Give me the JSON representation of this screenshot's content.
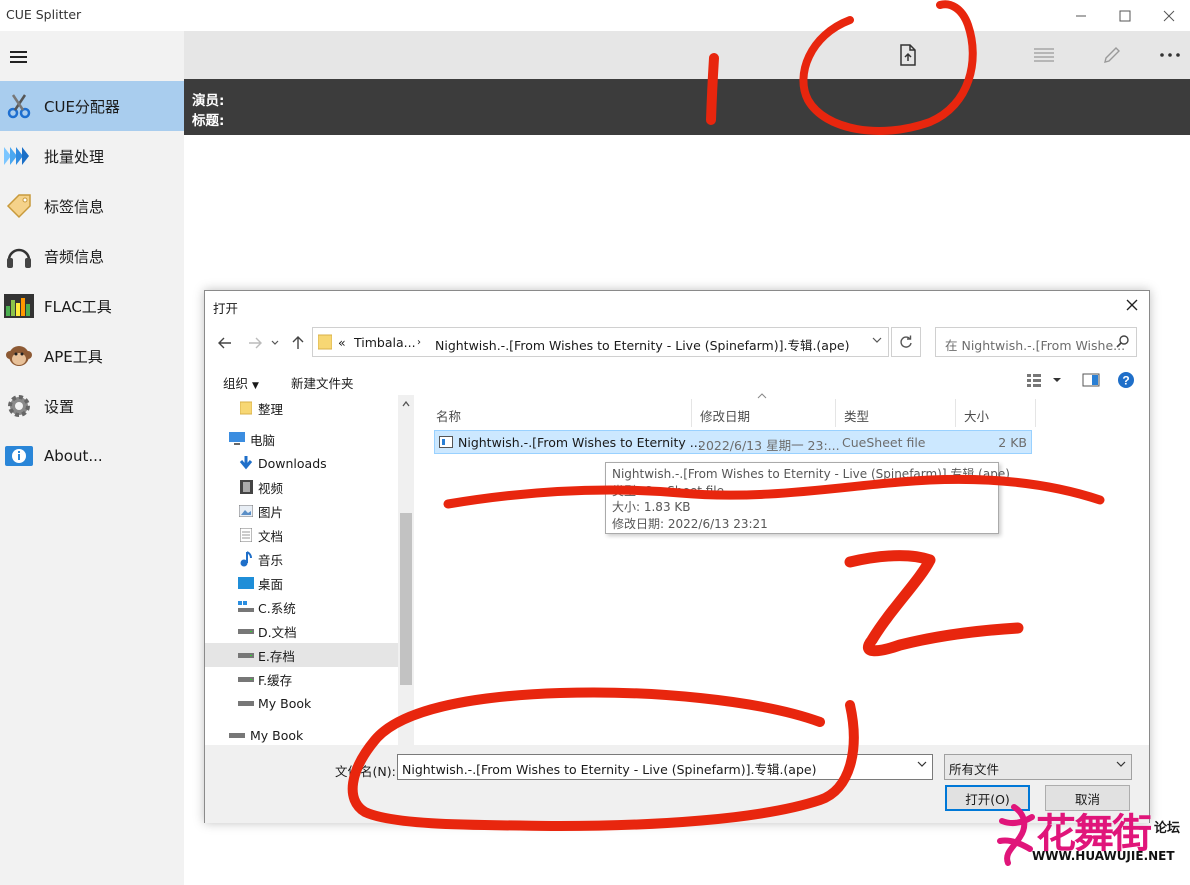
{
  "app": {
    "title": "CUE Splitter"
  },
  "sidebar": {
    "items": [
      {
        "label": "CUE分配器",
        "icon": "scissors-icon",
        "active": true
      },
      {
        "label": "批量处理",
        "icon": "batch-arrows-icon"
      },
      {
        "label": "标签信息",
        "icon": "tag-icon"
      },
      {
        "label": "音频信息",
        "icon": "headphones-icon"
      },
      {
        "label": "FLAC工具",
        "icon": "equalizer-icon"
      },
      {
        "label": "APE工具",
        "icon": "monkey-icon"
      },
      {
        "label": "设置",
        "icon": "gear-icon"
      },
      {
        "label": "About...",
        "icon": "info-icon"
      }
    ]
  },
  "info": {
    "artist_label": "演员:",
    "title_label": "标题:"
  },
  "dialog": {
    "title": "打开",
    "address": {
      "prefix": "«",
      "crumb1": "Timbala...",
      "crumb2": "Nightwish.-.[From Wishes to Eternity - Live (Spinefarm)].专辑.(ape)"
    },
    "search_placeholder": "在 Nightwish.-.[From Wishe...",
    "commands": {
      "organize": "组织",
      "new_folder": "新建文件夹"
    },
    "tree": [
      {
        "label": "整理",
        "icon": "folder-icon"
      },
      {
        "label": "电脑",
        "icon": "computer-icon"
      },
      {
        "label": "Downloads",
        "icon": "download-arrow-icon"
      },
      {
        "label": "视频",
        "icon": "video-icon"
      },
      {
        "label": "图片",
        "icon": "picture-icon"
      },
      {
        "label": "文档",
        "icon": "document-icon"
      },
      {
        "label": "音乐",
        "icon": "music-note-icon"
      },
      {
        "label": "桌面",
        "icon": "desktop-icon"
      },
      {
        "label": "C.系统",
        "icon": "system-drive-icon"
      },
      {
        "label": "D.文档",
        "icon": "drive-icon"
      },
      {
        "label": "E.存档",
        "icon": "drive-icon",
        "selected": true
      },
      {
        "label": "F.缓存",
        "icon": "drive-icon"
      },
      {
        "label": "My Book",
        "icon": "drive-icon"
      },
      {
        "label": "My Book",
        "icon": "drive-icon"
      }
    ],
    "columns": {
      "name": "名称",
      "date": "修改日期",
      "type": "类型",
      "size": "大小"
    },
    "file": {
      "name": "Nightwish.-.[From Wishes to Eternity ...",
      "date": "2022/6/13 星期一 23:...",
      "type": "CueSheet file",
      "size": "2 KB"
    },
    "tooltip": {
      "line1": "Nightwish.-.[From Wishes to Eternity - Live (Spinefarm)].专辑.(ape)",
      "line2": "类型: CueSheet file",
      "line3": "大小: 1.83 KB",
      "line4": "修改日期: 2022/6/13 23:21"
    },
    "filename_label": "文件名(N):",
    "filename_value": "Nightwish.-.[From Wishes to Eternity - Live (Spinefarm)].专辑.(ape)",
    "filter_value": "所有文件",
    "open_button": "打开(O)",
    "cancel_button": "取消"
  },
  "watermark": {
    "brand": "花舞街",
    "forum": "论坛",
    "url": "WWW.HUAWUJIE.NET"
  },
  "colors": {
    "accent": "#0078d7",
    "nav_active": "#a9cdee",
    "info_bar": "#3c3c3c",
    "annotation": "#e8260e"
  }
}
